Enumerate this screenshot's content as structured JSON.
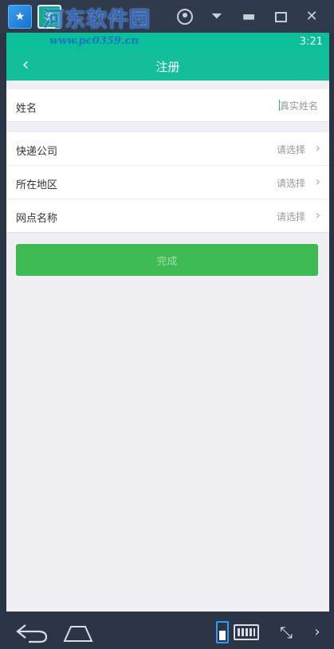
{
  "emulator": {
    "watermark": "河东软件园",
    "watermark_url": "www.pc0359.cn",
    "controls": {
      "close_glyph": "✕",
      "minimize_glyph": "▬",
      "menu_glyph": "⏷"
    },
    "bottom": {
      "fullscreen_glyph": "⤡",
      "more_glyph": "›"
    }
  },
  "status_bar": {
    "time": "3:21"
  },
  "app_bar": {
    "title": "注册",
    "back_glyph": "‹"
  },
  "form": {
    "name": {
      "label": "姓名",
      "placeholder": "真实姓名"
    },
    "rows": [
      {
        "label": "快递公司",
        "value": "请选择"
      },
      {
        "label": "所在地区",
        "value": "请选择"
      },
      {
        "label": "网点名称",
        "value": "请选择"
      }
    ],
    "chevron_glyph": "›",
    "submit_label": "完成"
  },
  "colors": {
    "primary": "#13be9b",
    "button": "#3dba52",
    "emulator_frame": "#2c3546"
  }
}
